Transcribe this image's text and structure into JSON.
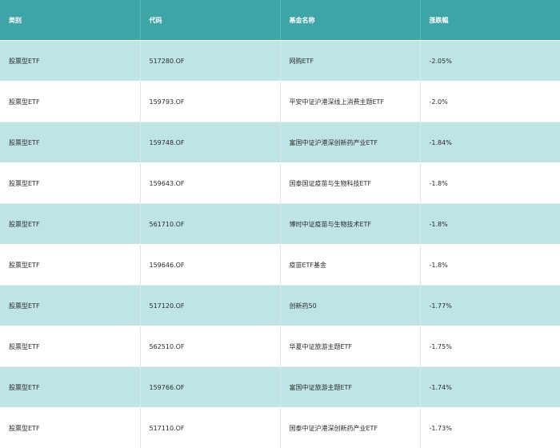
{
  "table": {
    "headers": [
      "类别",
      "代码",
      "基金名称",
      "涨跌幅"
    ],
    "rows": [
      {
        "category": "股票型ETF",
        "code": "517280.OF",
        "name": "网购ETF",
        "change": "-2.05%"
      },
      {
        "category": "股票型ETF",
        "code": "159793.OF",
        "name": "平安中证沪港深线上消费主题ETF",
        "change": "-2.0%"
      },
      {
        "category": "股票型ETF",
        "code": "159748.OF",
        "name": "富国中证沪港深创新药产业ETF",
        "change": "-1.84%"
      },
      {
        "category": "股票型ETF",
        "code": "159643.OF",
        "name": "国泰国证疫苗与生物科技ETF",
        "change": "-1.8%"
      },
      {
        "category": "股票型ETF",
        "code": "561710.OF",
        "name": "博时中证疫苗与生物技术ETF",
        "change": "-1.8%"
      },
      {
        "category": "股票型ETF",
        "code": "159646.OF",
        "name": "疫苗ETF基金",
        "change": "-1.8%"
      },
      {
        "category": "股票型ETF",
        "code": "517120.OF",
        "name": "创新药50",
        "change": "-1.77%"
      },
      {
        "category": "股票型ETF",
        "code": "562510.OF",
        "name": "华夏中证旅游主题ETF",
        "change": "-1.75%"
      },
      {
        "category": "股票型ETF",
        "code": "159766.OF",
        "name": "富国中证旅游主题ETF",
        "change": "-1.74%"
      },
      {
        "category": "股票型ETF",
        "code": "517110.OF",
        "name": "国泰中证沪港深创新药产业ETF",
        "change": "-1.73%"
      }
    ]
  },
  "colors": {
    "header_bg": "#3da5a7",
    "row_alt_bg": "#bfe4e6",
    "row_bg": "#ffffff"
  }
}
